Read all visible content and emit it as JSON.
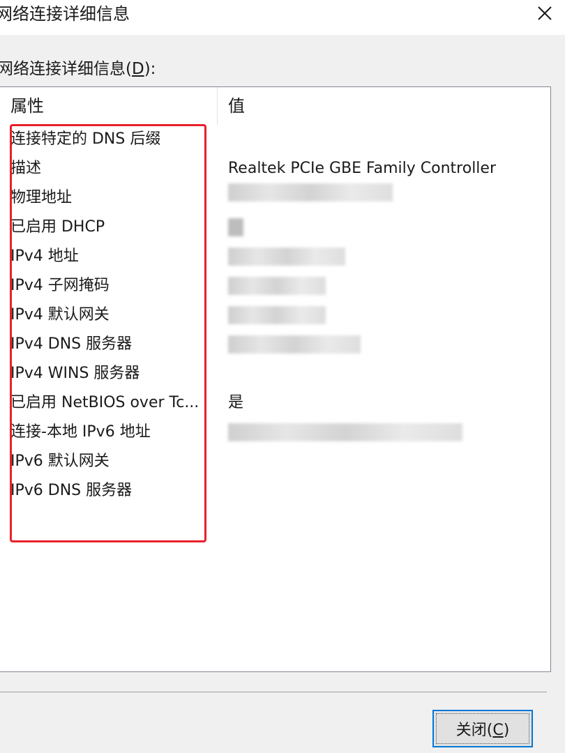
{
  "window": {
    "title": "网络连接详细信息",
    "close_icon": "close-icon"
  },
  "group": {
    "label_text": "网络连接详细信息(",
    "label_mnemonic": "D",
    "label_suffix": "):"
  },
  "list": {
    "headers": {
      "property": "属性",
      "value": "值"
    },
    "rows": [
      {
        "property": "连接特定的 DNS 后缀",
        "value": ""
      },
      {
        "property": "描述",
        "value": "Realtek PCIe GBE Family Controller"
      },
      {
        "property": "物理地址",
        "value": ""
      },
      {
        "property": "已启用 DHCP",
        "value": ""
      },
      {
        "property": "IPv4 地址",
        "value": ""
      },
      {
        "property": "IPv4 子网掩码",
        "value": ""
      },
      {
        "property": "IPv4 默认网关",
        "value": ""
      },
      {
        "property": "IPv4 DNS 服务器",
        "value": ""
      },
      {
        "property": "IPv4 WINS 服务器",
        "value": ""
      },
      {
        "property": "已启用 NetBIOS over Tc...",
        "value": "是"
      },
      {
        "property": "连接-本地 IPv6 地址",
        "value": ""
      },
      {
        "property": "IPv6 默认网关",
        "value": ""
      },
      {
        "property": "IPv6 DNS 服务器",
        "value": ""
      }
    ]
  },
  "annotation": {
    "highlight_color": "#e8202a"
  },
  "footer": {
    "close_text": "关闭(",
    "close_mnemonic": "C",
    "close_suffix": ")"
  }
}
